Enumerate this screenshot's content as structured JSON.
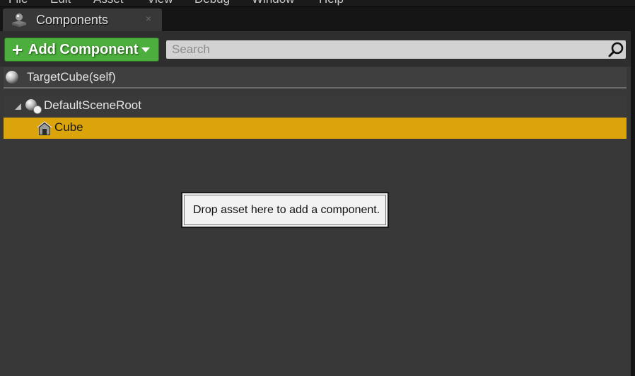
{
  "menu": [
    "File",
    "Edit",
    "Asset",
    "View",
    "Debug",
    "Window",
    "Help"
  ],
  "tab": {
    "label": "Components",
    "close_glyph": "×",
    "icon": "components-icon"
  },
  "toolbar": {
    "add_component_label": "Add Component",
    "add_icon_glyph": "+",
    "search_placeholder": "Search",
    "search_value": ""
  },
  "self_item": {
    "label": "TargetCube(self)",
    "icon": "sphere-icon"
  },
  "tree": {
    "root": {
      "label": "DefaultSceneRoot",
      "expanded": true,
      "icon": "scene-root-icon"
    },
    "children": [
      {
        "label": "Cube",
        "selected": true,
        "icon": "static-mesh-icon"
      }
    ]
  },
  "hint": {
    "text": "Drop asset here to add a component."
  },
  "colors": {
    "panel_bg": "#383838",
    "add_button": "#4cae3c",
    "selection": "#dba40a",
    "tooltip_bg": "#f2f2f2"
  }
}
